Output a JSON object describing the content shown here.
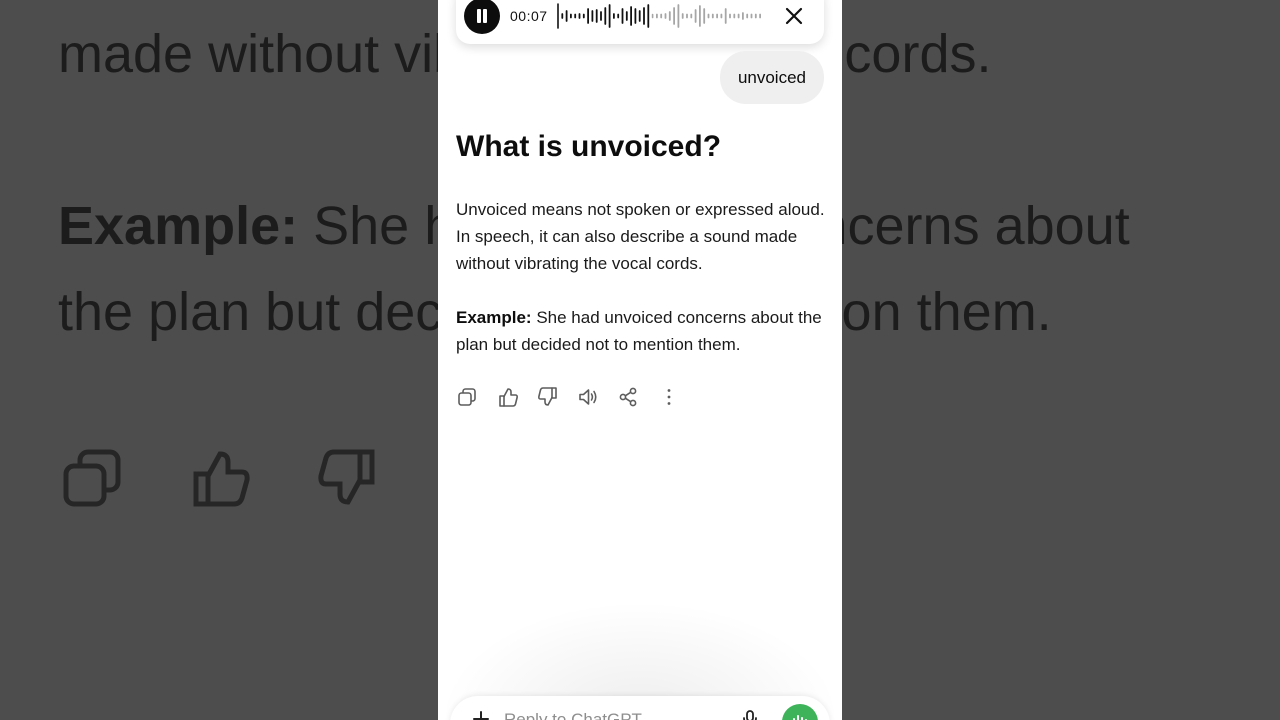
{
  "recording": {
    "time": "00:07"
  },
  "conversation": {
    "user_message": "unvoiced",
    "title": "What is unvoiced?",
    "definition": "Unvoiced means not spoken or expressed aloud. In speech, it can also describe a sound made without vibrating the vocal cords.",
    "example_label": "Example:",
    "example_text": " She had unvoiced concerns about the plan but decided not to mention them."
  },
  "background": {
    "line1": "made without vibrating the vocal cords.",
    "example_label": "Example:",
    "line2_rest": " She had unvoiced concerns about",
    "line3": "the plan but decided not to mention them."
  },
  "actions": [
    {
      "icon": "copy-icon"
    },
    {
      "icon": "thumbs-up-icon"
    },
    {
      "icon": "thumbs-down-icon"
    },
    {
      "icon": "speaker-icon"
    },
    {
      "icon": "share-icon"
    },
    {
      "icon": "more-icon"
    }
  ],
  "composer": {
    "placeholder": "Reply to ChatGPT"
  },
  "colors": {
    "voice_button": "#3fb35a",
    "bubble": "#efefef",
    "backdrop": "#4d4d4d"
  }
}
